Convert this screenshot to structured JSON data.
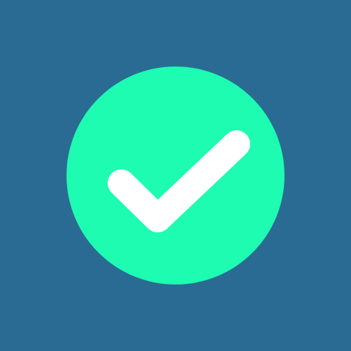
{
  "icon": {
    "name": "checkmark-circle-icon",
    "background_color": "#2a6b94",
    "circle_color": "#1dfcb0",
    "check_color": "#ffffff"
  }
}
